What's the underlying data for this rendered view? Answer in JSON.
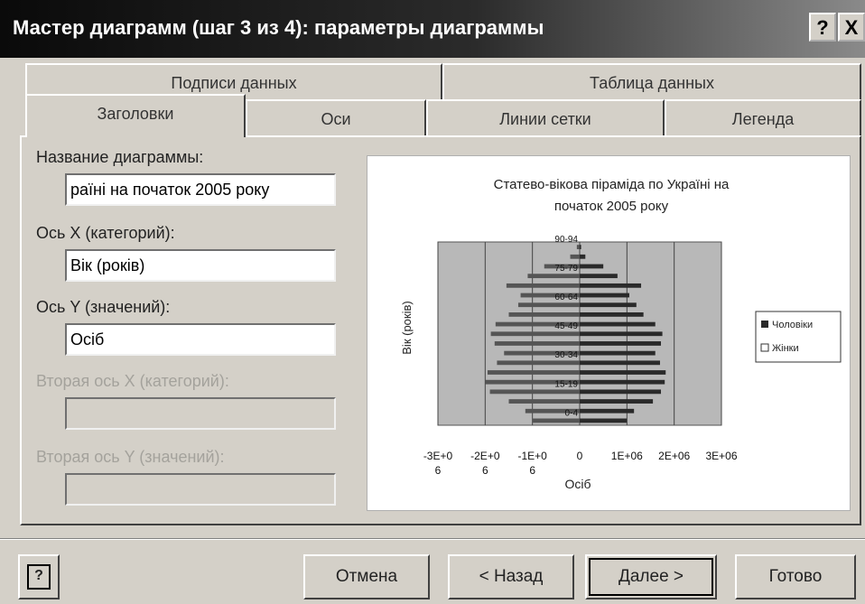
{
  "window": {
    "title": "Мастер диаграмм (шаг 3 из 4): параметры диаграммы",
    "help_btn": "?",
    "close_btn": "X"
  },
  "tabs": {
    "back_row": [
      "Подписи данных",
      "Таблица данных"
    ],
    "front_row": [
      "Заголовки",
      "Оси",
      "Линии сетки",
      "Легенда"
    ],
    "active": "Заголовки"
  },
  "form": {
    "chart_title_label": "Название диаграммы:",
    "chart_title_value": "раїні на початок 2005 року",
    "x_axis_label": "Ось X (категорий):",
    "x_axis_value": "Вік (років)",
    "y_axis_label": "Ось Y (значений):",
    "y_axis_value": "Осіб",
    "x2_axis_label": "Вторая ось X (категорий):",
    "x2_axis_value": "",
    "y2_axis_label": "Вторая ось Y (значений):",
    "y2_axis_value": ""
  },
  "chart_data": {
    "type": "bar",
    "title": "Статево-вікова піраміда по Україні на початок 2005 року",
    "xlabel": "Осіб",
    "ylabel": "Вік (років)",
    "xlim": [
      -3000000,
      3000000
    ],
    "x_ticks": [
      "-3E+06",
      "-2E+06",
      "-1E+06",
      "0",
      "1E+06",
      "2E+06",
      "3E+06"
    ],
    "y_tick_labels": [
      "0-4",
      "15-19",
      "30-34",
      "45-49",
      "60-64",
      "75-79",
      "90-94"
    ],
    "grid": true,
    "legend_position": "right",
    "series": [
      {
        "name": "Чоловіки",
        "values": [
          1000000,
          1150000,
          1550000,
          1720000,
          1800000,
          1820000,
          1700000,
          1600000,
          1720000,
          1750000,
          1600000,
          1350000,
          1200000,
          1050000,
          1300000,
          800000,
          500000,
          120000,
          30000
        ]
      },
      {
        "name": "Жінки",
        "values": [
          -1000000,
          -1150000,
          -1500000,
          -1900000,
          -2000000,
          -1950000,
          -1750000,
          -1600000,
          -1800000,
          -1880000,
          -1780000,
          -1500000,
          -1300000,
          -1250000,
          -1550000,
          -1100000,
          -750000,
          -200000,
          -60000
        ]
      }
    ],
    "colors": {
      "men": "#2a2a2a",
      "women": "#555555",
      "plot_bg": "#b8b8b8"
    }
  },
  "buttons": {
    "help": "?",
    "cancel": "Отмена",
    "back": "< Назад",
    "next": "Далее >",
    "finish": "Готово"
  }
}
